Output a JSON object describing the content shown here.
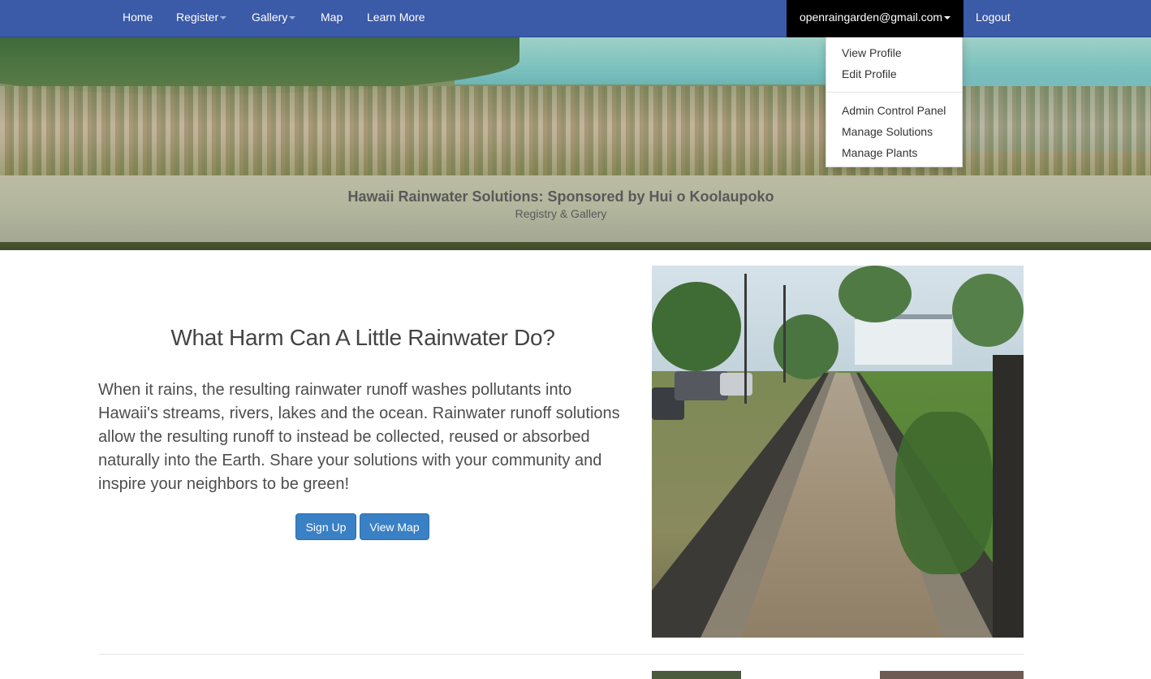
{
  "navbar": {
    "items": [
      {
        "label": "Home"
      },
      {
        "label": "Register",
        "has_caret": true
      },
      {
        "label": "Gallery",
        "has_caret": true
      },
      {
        "label": "Map"
      },
      {
        "label": "Learn More"
      }
    ],
    "user_email": "openraingarden@gmail.com",
    "logout_label": "Logout"
  },
  "user_menu": {
    "items": [
      {
        "label": "View Profile"
      },
      {
        "label": "Edit Profile"
      },
      {
        "label": "Admin Control Panel"
      },
      {
        "label": "Manage Solutions"
      },
      {
        "label": "Manage Plants"
      }
    ]
  },
  "hero": {
    "title": "Hawaii Rainwater Solutions: Sponsored by Hui o Koolaupoko",
    "subtitle": "Registry & Gallery"
  },
  "main": {
    "heading": "What Harm Can A Little Rainwater Do?",
    "paragraph": "When it rains, the resulting rainwater runoff washes pollutants into Hawaii's streams, rivers, lakes and the ocean. Rainwater runoff solutions allow the resulting runoff to instead be collected, reused or absorbed naturally into the Earth. Share your solutions with your community and inspire your neighbors to be green!",
    "sign_up_label": "Sign Up",
    "view_map_label": "View Map"
  },
  "colors": {
    "navbar": "#3b5aa8",
    "user_menu_bg": "#000000",
    "button": "#3a80c4"
  }
}
